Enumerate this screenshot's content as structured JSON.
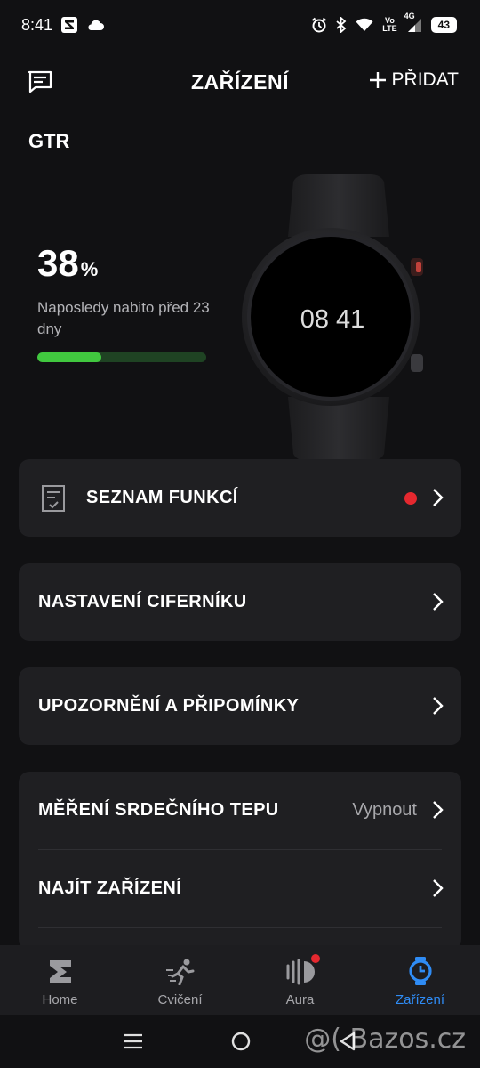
{
  "status_bar": {
    "time": "8:41",
    "net_top": "Vo",
    "net_bottom": "LTE",
    "signal_label": "4G",
    "battery": "43"
  },
  "header": {
    "title": "ZAŘÍZENÍ",
    "add_label": "PŘIDAT"
  },
  "device": {
    "name": "GTR",
    "battery_percent": "38",
    "battery_unit": "%",
    "battery_level": 0.38,
    "last_charged": "Naposledy nabito před 23 dny",
    "watch_time": "08 41"
  },
  "menu": {
    "feature_list": "SEZNAM FUNKCÍ",
    "watchface": "NASTAVENÍ CIFERNÍKU",
    "notifications": "UPOZORNĚNÍ A PŘIPOMÍNKY",
    "heart_rate": "MĚŘENÍ SRDEČNÍHO TEPU",
    "heart_rate_value": "Vypnout",
    "find_device": "NAJÍT ZAŘÍZENÍ"
  },
  "bottom_nav": {
    "home": "Home",
    "workout": "Cvičení",
    "aura": "Aura",
    "devices": "Zařízení"
  },
  "watermark": "@( Bazos.cz",
  "colors": {
    "accent": "#2f8cf5",
    "battery_fill": "#41c83f",
    "alert": "#e5282f",
    "card": "#1f1f22",
    "background": "#111113"
  }
}
